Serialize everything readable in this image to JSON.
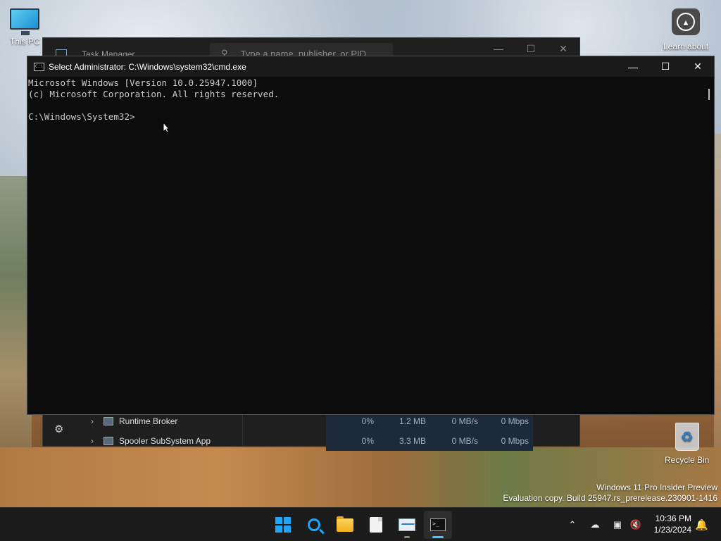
{
  "desktop": {
    "icons": {
      "this_pc": "This PC",
      "learn_about": "Learn about",
      "recycle_bin": "Recycle Bin"
    },
    "watermark": {
      "line1": "Windows 11 Pro Insider Preview",
      "line2": "Evaluation copy. Build 25947.rs_prerelease.230901-1416"
    }
  },
  "task_manager": {
    "title": "Task Manager",
    "search_placeholder": "Type a name, publisher, or PID",
    "rows": [
      {
        "name": "Runtime Broker",
        "cpu": "0%",
        "memory": "1.2 MB",
        "disk": "0 MB/s",
        "network": "0 Mbps"
      },
      {
        "name": "Spooler SubSystem App",
        "cpu": "0%",
        "memory": "3.3 MB",
        "disk": "0 MB/s",
        "network": "0 Mbps"
      }
    ]
  },
  "cmd": {
    "title": "Select Administrator: C:\\Windows\\system32\\cmd.exe",
    "lines": [
      "Microsoft Windows [Version 10.0.25947.1000]",
      "(c) Microsoft Corporation. All rights reserved.",
      "",
      "C:\\Windows\\System32>"
    ]
  },
  "taskbar": {
    "apps": [
      "start-icon",
      "search-icon",
      "file-explorer-icon",
      "notepad-icon",
      "task-manager-icon",
      "terminal-icon"
    ],
    "clock": {
      "time": "10:36 PM",
      "date": "1/23/2024"
    }
  },
  "colors": {
    "accent": "#4cc2ff",
    "cmd_bg": "#0c0c0c",
    "cmd_text": "#cccccc",
    "taskbar_bg": "#1c1c1c"
  }
}
